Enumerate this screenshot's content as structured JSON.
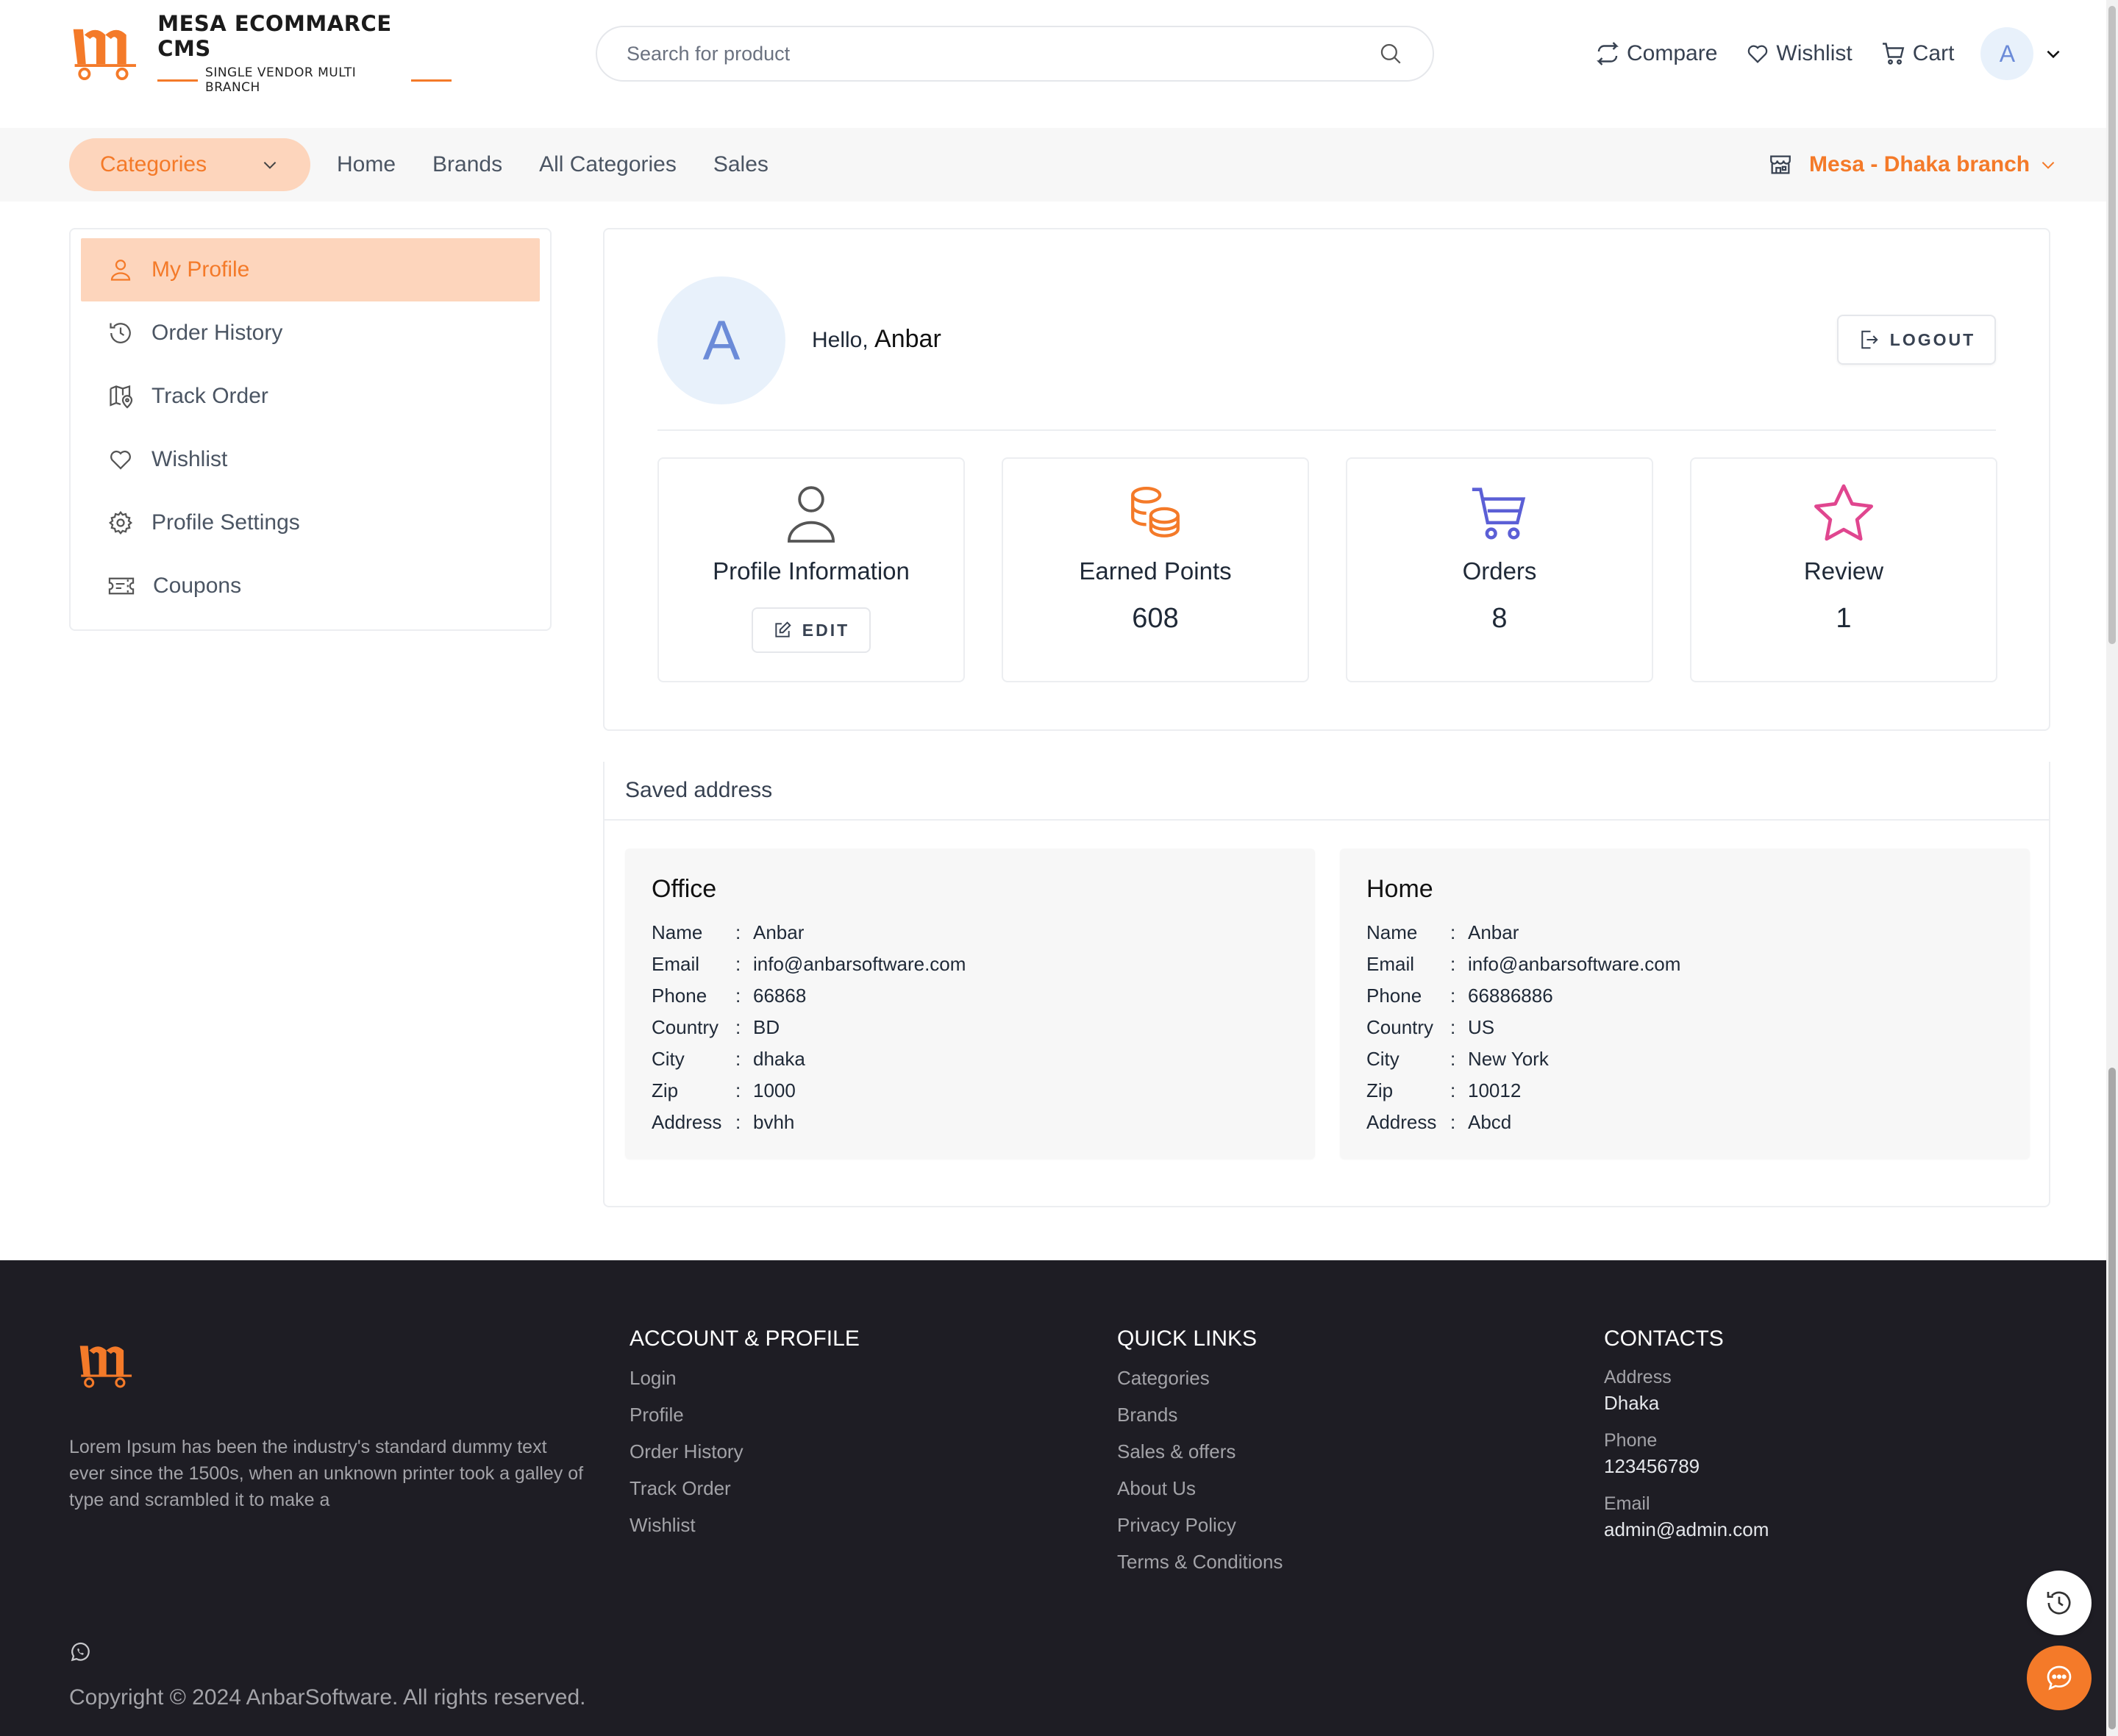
{
  "brand": {
    "title": "MESA ECOMMARCE CMS",
    "subtitle": "SINGLE VENDOR MULTI BRANCH",
    "accent_color": "#f47a29",
    "logo_icon": "m-cart-logo"
  },
  "search": {
    "placeholder": "Search for product",
    "icon": "search-icon"
  },
  "header_actions": {
    "compare": "Compare",
    "wishlist": "Wishlist",
    "cart": "Cart",
    "avatar_initial": "A"
  },
  "nav": {
    "categories": "Categories",
    "links": [
      "Home",
      "Brands",
      "All Categories",
      "Sales"
    ],
    "branch": "Mesa - Dhaka branch"
  },
  "sidebar": {
    "items": [
      {
        "label": "My Profile",
        "icon": "user-icon",
        "active": true
      },
      {
        "label": "Order History",
        "icon": "history-icon"
      },
      {
        "label": "Track Order",
        "icon": "map-pin-icon"
      },
      {
        "label": "Wishlist",
        "icon": "heart-icon"
      },
      {
        "label": "Profile Settings",
        "icon": "gear-icon"
      },
      {
        "label": "Coupons",
        "icon": "ticket-icon"
      }
    ]
  },
  "profile": {
    "avatar_initial": "A",
    "greeting": "Hello,",
    "name": "Anbar",
    "logout": "LOGOUT",
    "stats": {
      "profile_info": {
        "label": "Profile Information",
        "button": "EDIT"
      },
      "earned_points": {
        "label": "Earned Points",
        "value": "608",
        "color": "#f47a29"
      },
      "orders": {
        "label": "Orders",
        "value": "8",
        "color": "#5b5fd6"
      },
      "review": {
        "label": "Review",
        "value": "1",
        "color": "#e0468f"
      }
    }
  },
  "saved_address": {
    "heading": "Saved address",
    "keys": {
      "name": "Name",
      "email": "Email",
      "phone": "Phone",
      "country": "Country",
      "city": "City",
      "zip": "Zip",
      "address": "Address"
    },
    "separator": ":",
    "office": {
      "title": "Office",
      "name": "Anbar",
      "email": "info@anbarsoftware.com",
      "phone": "66868",
      "country": "BD",
      "city": "dhaka",
      "zip": "1000",
      "address": "bvhh"
    },
    "home": {
      "title": "Home",
      "name": "Anbar",
      "email": "info@anbarsoftware.com",
      "phone": "66886886",
      "country": "US",
      "city": "New York",
      "zip": "10012",
      "address": "Abcd"
    }
  },
  "footer": {
    "description": "Lorem Ipsum has been the industry's standard dummy text ever since the 1500s, when an unknown printer took a galley of type and scrambled it to make a",
    "account": {
      "title": "ACCOUNT & PROFILE",
      "links": [
        "Login",
        "Profile",
        "Order History",
        "Track Order",
        "Wishlist"
      ]
    },
    "quick": {
      "title": "QUICK LINKS",
      "links": [
        "Categories",
        "Brands",
        "Sales & offers",
        "About Us",
        "Privacy Policy",
        "Terms & Conditions"
      ]
    },
    "contacts": {
      "title": "CONTACTS",
      "address_label": "Address",
      "address": "Dhaka",
      "phone_label": "Phone",
      "phone": "123456789",
      "email_label": "Email",
      "email": "admin@admin.com"
    },
    "copyright": "Copyright © 2024 AnbarSoftware. All rights reserved."
  }
}
